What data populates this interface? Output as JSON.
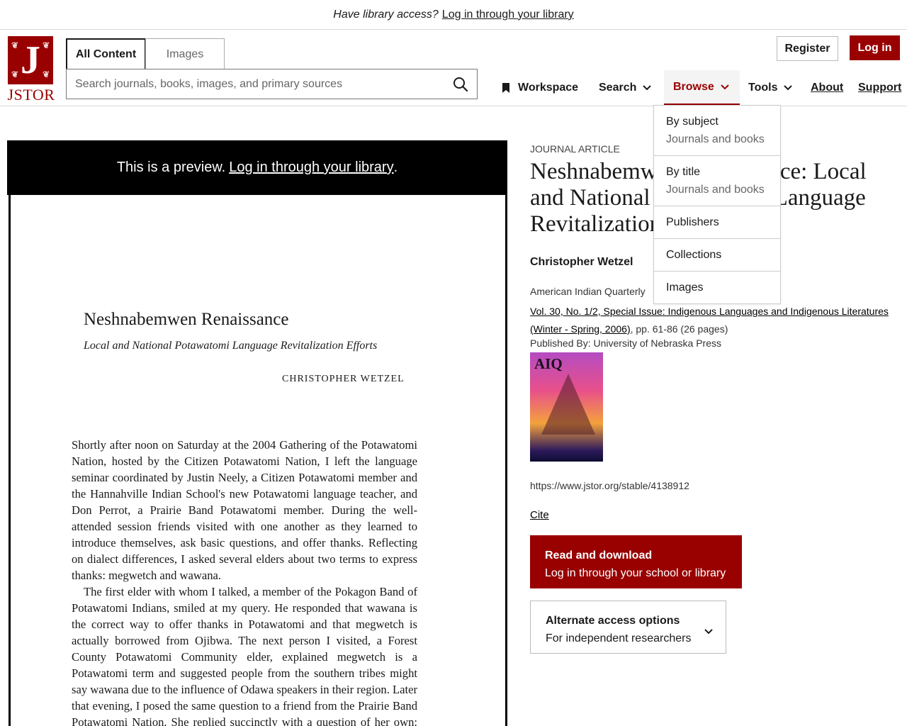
{
  "banner": {
    "question": "Have library access?",
    "link": "Log in through your library"
  },
  "logo": {
    "glyph": "J",
    "text": "JSTOR",
    "brand_color": "#990000"
  },
  "search": {
    "tabs": [
      {
        "label": "All Content"
      },
      {
        "label": "Images"
      }
    ],
    "placeholder": "Search journals, books, images, and primary sources"
  },
  "nav": {
    "workspace": "Workspace",
    "search": "Search",
    "browse": "Browse",
    "tools": "Tools",
    "about": "About",
    "support": "Support"
  },
  "auth": {
    "register": "Register",
    "login": "Log in"
  },
  "preview": {
    "text": "This is a preview.",
    "link": "Log in through your library",
    "trailing": ".",
    "page": {
      "title": "Neshnabemwen Renaissance",
      "subtitle": "Local and National Potawatomi Language Revitalization Efforts",
      "author": "CHRISTOPHER WETZEL",
      "paragraph1": "Shortly after noon on Saturday at the 2004 Gathering of the Potawatomi Nation, hosted by the Citizen Potawatomi Nation, I left the language seminar coordinated by Justin Neely, a Citizen Potawatomi member and the Hannahville Indian School's new Potawatomi language teacher, and Don Perrot, a Prairie Band Potawatomi member. During the well-attended session friends visited with one another as they learned to introduce themselves, ask basic questions, and offer thanks. Reflecting on dialect differences, I asked several elders about two terms to express thanks: megwetch and wawana.",
      "paragraph2": "The first elder with whom I talked, a member of the Pokagon Band of Potawatomi Indians, smiled at my query. He responded that wawana is the correct way to offer thanks in Potawatomi and that megwetch is actually borrowed from Ojibwa. The next person I visited, a Forest County Potawatomi Community elder, explained megwetch is a Potawatomi term and suggested people from the southern tribes might say wawana due to the influence of Odawa speakers in their region. Later that evening, I posed the same question to a friend from the Prairie Band Potawatomi Nation. She replied succinctly with a question of her own: So"
    }
  },
  "article": {
    "type": "JOURNAL ARTICLE",
    "title": "Neshnabemwen Renaissance: Local and National Potawatomi Language Revitalization Efforts",
    "author": "Christopher Wetzel",
    "journal": "American Indian Quarterly",
    "issue_link": "Vol. 30, No. 1/2, Special Issue: Indigenous Languages and Indigenous Literatures (Winter - Spring, 2006)",
    "pages": ", pp. 61-86 (26 pages)",
    "publisher": "Published By: University of Nebraska Press",
    "cover_label": "AIQ",
    "url": "https://www.jstor.org/stable/4138912",
    "cite": "Cite"
  },
  "actions": {
    "read_title": "Read and download",
    "read_sub": "Log in through your school or library",
    "alt_title": "Alternate access options",
    "alt_sub": "For independent researchers"
  },
  "browse_menu": [
    {
      "label": "By subject",
      "sub": "Journals and books"
    },
    {
      "label": "By title",
      "sub": "Journals and books"
    },
    {
      "label": "Publishers"
    },
    {
      "label": "Collections"
    },
    {
      "label": "Images"
    }
  ]
}
